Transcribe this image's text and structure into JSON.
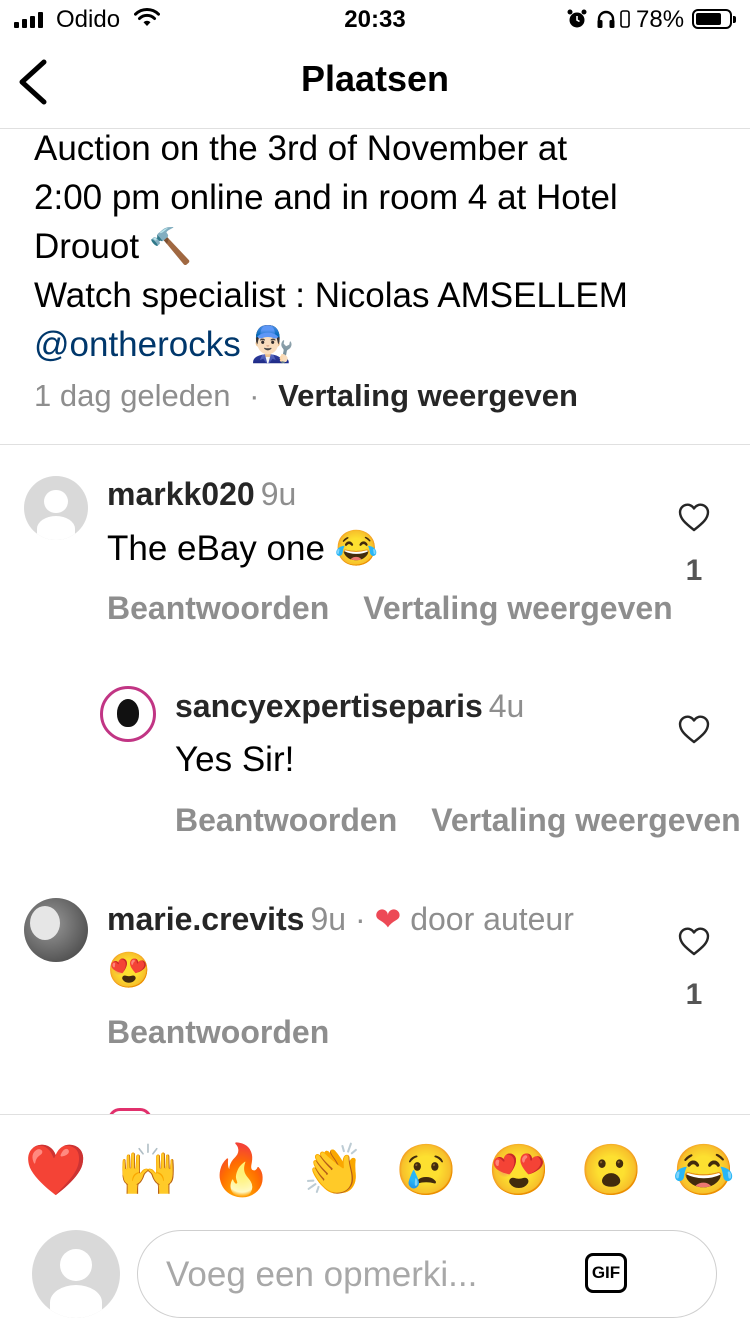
{
  "status_bar": {
    "carrier": "Odido",
    "time": "20:33",
    "battery_pct": "78%",
    "battery_level": 0.78
  },
  "header": {
    "title": "Plaatsen"
  },
  "caption": {
    "lines": [
      "Auction on the 3rd of November at",
      "2:00 pm online and in room 4 at Hotel",
      "Drouot 🔨",
      "Watch specialist : Nicolas AMSELLEM"
    ],
    "mention": "@ontherocks",
    "mention_emoji": "👨🏻‍🔧",
    "time_ago": "1 dag geleden",
    "separator": "·",
    "translate": "Vertaling weergeven"
  },
  "comments": [
    {
      "username": "markk020",
      "time": "9u",
      "text": "The eBay one 😂",
      "reply": "Beantwoorden",
      "translate": "Vertaling weergeven",
      "likes": "1"
    },
    {
      "username": "sancyexpertiseparis",
      "time": "4u",
      "text": "Yes Sir!",
      "reply": "Beantwoorden",
      "translate": "Vertaling weergeven"
    },
    {
      "username": "marie.crevits",
      "time": "9u",
      "separator": "·",
      "heart": "❤",
      "by_author": "door auteur",
      "text": "😍",
      "reply": "Beantwoorden",
      "likes": "1"
    }
  ],
  "quick_reactions": [
    "❤️",
    "🙌",
    "🔥",
    "👏",
    "😢",
    "😍",
    "😮",
    "😂"
  ],
  "comment_input": {
    "placeholder": "Voeg een opmerki...",
    "gif_label": "GIF"
  },
  "colors": {
    "mention": "#00376b",
    "secondary_text": "#8e8e8e",
    "heart": "#ed4956",
    "story_ring": "#c13584"
  }
}
